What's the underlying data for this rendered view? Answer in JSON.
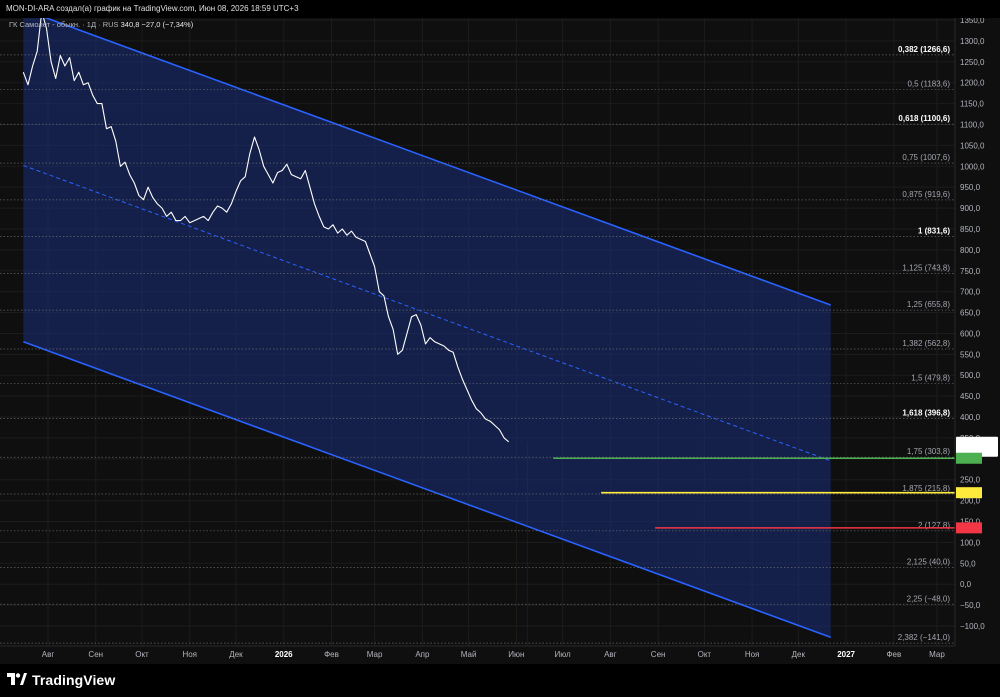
{
  "header": {
    "attribution": "MON-DI-ARA создал(а) график на TradingView.com, Июн 08, 2026 18:59 UTC+3"
  },
  "legend": {
    "symbol": "ГК Самолет - обыкн. · 1Д · RUS",
    "last_value": "340,8",
    "change": "−27,0 (−7,34%)"
  },
  "footer": {
    "brand": "TradingView"
  },
  "colors": {
    "background": "#0f0f0f",
    "channel_line": "#2962ff",
    "channel_fill": "#1a2f7a",
    "price_line": "#ffffff",
    "target_green": "#4caf50",
    "target_yellow": "#ffeb3b",
    "target_red": "#f23645"
  },
  "chart_data": {
    "type": "line",
    "title": "ГК Самолет - обыкн.",
    "interval": "1Д",
    "exchange": "RUS",
    "x_axis_labels": [
      "Авг",
      "Сен",
      "Окт",
      "Ноя",
      "Дек",
      "2026",
      "Фев",
      "Мар",
      "Апр",
      "Май",
      "Июн",
      "Июл",
      "Авг",
      "Сен",
      "Окт",
      "Ноя",
      "Дек",
      "2027",
      "Фев",
      "Мар"
    ],
    "x_axis_dates": [
      "2025-08-01",
      "2025-09-01",
      "2025-10-01",
      "2025-11-01",
      "2025-12-01",
      "2026-01-01",
      "2026-02-01",
      "2026-03-01",
      "2026-04-01",
      "2026-05-01",
      "2026-06-01",
      "2026-07-01",
      "2026-08-01",
      "2026-09-01",
      "2026-10-01",
      "2026-11-01",
      "2026-12-01",
      "2027-01-01",
      "2027-02-01",
      "2027-03-01"
    ],
    "y_axis_ticks": [
      1350,
      1300,
      1250,
      1200,
      1150,
      1100,
      1050,
      1000,
      950,
      900,
      850,
      800,
      750,
      700,
      650,
      600,
      550,
      500,
      450,
      400,
      350,
      300,
      250,
      200,
      150,
      100,
      50,
      0,
      -50,
      -100
    ],
    "y_axis_tick_labels": [
      "1350,0",
      "1300,0",
      "1250,0",
      "1200,0",
      "1150,0",
      "1100,0",
      "1050,0",
      "1000,0",
      "950,0",
      "900,0",
      "850,0",
      "800,0",
      "750,0",
      "700,0",
      "650,0",
      "600,0",
      "550,0",
      "500,0",
      "450,0",
      "400,0",
      "350,0",
      "300,0",
      "250,0",
      "200,0",
      "150,0",
      "100,0",
      "50,0",
      "0,0",
      "−50,0",
      "−100,0"
    ],
    "ylim": [
      -140,
      1395
    ],
    "price_series": {
      "name": "ГК Самолет - обыкн.",
      "x": [
        "2025-07-16",
        "2025-07-19",
        "2025-07-22",
        "2025-07-25",
        "2025-07-28",
        "2025-07-31",
        "2025-08-03",
        "2025-08-06",
        "2025-08-09",
        "2025-08-12",
        "2025-08-15",
        "2025-08-18",
        "2025-08-21",
        "2025-08-24",
        "2025-08-27",
        "2025-08-30",
        "2025-09-02",
        "2025-09-05",
        "2025-09-08",
        "2025-09-11",
        "2025-09-14",
        "2025-09-17",
        "2025-09-20",
        "2025-09-23",
        "2025-09-26",
        "2025-09-29",
        "2025-10-02",
        "2025-10-05",
        "2025-10-08",
        "2025-10-11",
        "2025-10-14",
        "2025-10-17",
        "2025-10-20",
        "2025-10-23",
        "2025-10-26",
        "2025-10-29",
        "2025-11-01",
        "2025-11-04",
        "2025-11-07",
        "2025-11-10",
        "2025-11-13",
        "2025-11-16",
        "2025-11-19",
        "2025-11-22",
        "2025-11-25",
        "2025-11-28",
        "2025-12-01",
        "2025-12-04",
        "2025-12-07",
        "2025-12-10",
        "2025-12-13",
        "2025-12-16",
        "2025-12-19",
        "2025-12-22",
        "2025-12-25",
        "2025-12-28",
        "2025-12-31",
        "2026-01-03",
        "2026-01-06",
        "2026-01-09",
        "2026-01-12",
        "2026-01-15",
        "2026-01-18",
        "2026-01-21",
        "2026-01-24",
        "2026-01-27",
        "2026-01-30",
        "2026-02-02",
        "2026-02-05",
        "2026-02-08",
        "2026-02-11",
        "2026-02-14",
        "2026-02-17",
        "2026-02-20",
        "2026-02-23",
        "2026-02-26",
        "2026-03-01",
        "2026-03-04",
        "2026-03-07",
        "2026-03-10",
        "2026-03-13",
        "2026-03-16",
        "2026-03-19",
        "2026-03-22",
        "2026-03-25",
        "2026-03-28",
        "2026-03-31",
        "2026-04-03",
        "2026-04-06",
        "2026-04-09",
        "2026-04-12",
        "2026-04-15",
        "2026-04-18",
        "2026-04-21",
        "2026-04-24",
        "2026-04-27",
        "2026-04-30",
        "2026-05-03",
        "2026-05-06",
        "2026-05-09",
        "2026-05-12",
        "2026-05-15",
        "2026-05-18",
        "2026-05-21",
        "2026-05-24",
        "2026-05-27",
        "2026-05-30",
        "2026-06-02",
        "2026-06-05",
        "2026-06-08"
      ],
      "y": [
        1225,
        1195,
        1240,
        1275,
        1370,
        1330,
        1250,
        1210,
        1265,
        1240,
        1260,
        1205,
        1225,
        1195,
        1200,
        1170,
        1150,
        1150,
        1090,
        1095,
        1060,
        1000,
        1010,
        980,
        960,
        930,
        920,
        950,
        925,
        910,
        900,
        880,
        890,
        870,
        870,
        880,
        865,
        870,
        875,
        880,
        870,
        890,
        905,
        900,
        890,
        910,
        940,
        965,
        975,
        1030,
        1070,
        1040,
        1000,
        980,
        960,
        985,
        990,
        1005,
        980,
        975,
        970,
        990,
        950,
        910,
        880,
        855,
        850,
        860,
        840,
        850,
        835,
        845,
        830,
        825,
        820,
        790,
        760,
        700,
        690,
        640,
        610,
        550,
        560,
        600,
        640,
        645,
        620,
        575,
        590,
        580,
        575,
        570,
        560,
        555,
        520,
        490,
        465,
        440,
        420,
        410,
        395,
        390,
        380,
        370,
        350,
        340.8
      ],
      "last": 340.8
    },
    "regression_channel": {
      "start_date": "2025-07-16",
      "end_date": "2026-12-22",
      "upper": [
        1375,
        668
      ],
      "middle": [
        1002,
        295
      ],
      "lower": [
        580,
        -127
      ]
    },
    "fib_levels": [
      {
        "label": "0,382 (1266,6)",
        "value": 1266.6,
        "bold": true
      },
      {
        "label": "0,5 (1183,6)",
        "value": 1183.6,
        "bold": false
      },
      {
        "label": "0,618 (1100,6)",
        "value": 1100.6,
        "bold": true
      },
      {
        "label": "0,75 (1007,6)",
        "value": 1007.6,
        "bold": false
      },
      {
        "label": "0,875 (919,6)",
        "value": 919.6,
        "bold": false
      },
      {
        "label": "1 (831,6)",
        "value": 831.6,
        "bold": true
      },
      {
        "label": "1,125 (743,8)",
        "value": 743.8,
        "bold": false
      },
      {
        "label": "1,25 (655,8)",
        "value": 655.8,
        "bold": false
      },
      {
        "label": "1,382 (562,8)",
        "value": 562.8,
        "bold": false
      },
      {
        "label": "1,5 (479,8)",
        "value": 479.8,
        "bold": false
      },
      {
        "label": "1,618 (396,8)",
        "value": 396.8,
        "bold": true
      },
      {
        "label": "1,75 (303,8)",
        "value": 303.8,
        "bold": false
      },
      {
        "label": "1,875 (215,8)",
        "value": 215.8,
        "bold": false
      },
      {
        "label": "2 (127,8)",
        "value": 127.8,
        "bold": false
      },
      {
        "label": "2,125 (40,0)",
        "value": 40.0,
        "bold": false
      },
      {
        "label": "2,25 (−48,0)",
        "value": -48.0,
        "bold": false
      },
      {
        "label": "2,382 (−141,0)",
        "value": -141.0,
        "bold": false
      }
    ],
    "target_lines": [
      {
        "value": 301.4,
        "label": "301,4",
        "color": "#4caf50",
        "text_color": "#ffffff",
        "start_date": "2026-06-25"
      },
      {
        "value": 219.0,
        "label": "219,0",
        "color": "#ffeb3b",
        "text_color": "#000000",
        "start_date": "2026-07-26"
      },
      {
        "value": 134.8,
        "label": "134,8",
        "color": "#f23645",
        "text_color": "#ffffff",
        "start_date": "2026-08-30"
      }
    ],
    "price_tag": {
      "value": 340.8,
      "label": "340,8",
      "countdown": "04:50:51"
    },
    "grid": true
  }
}
